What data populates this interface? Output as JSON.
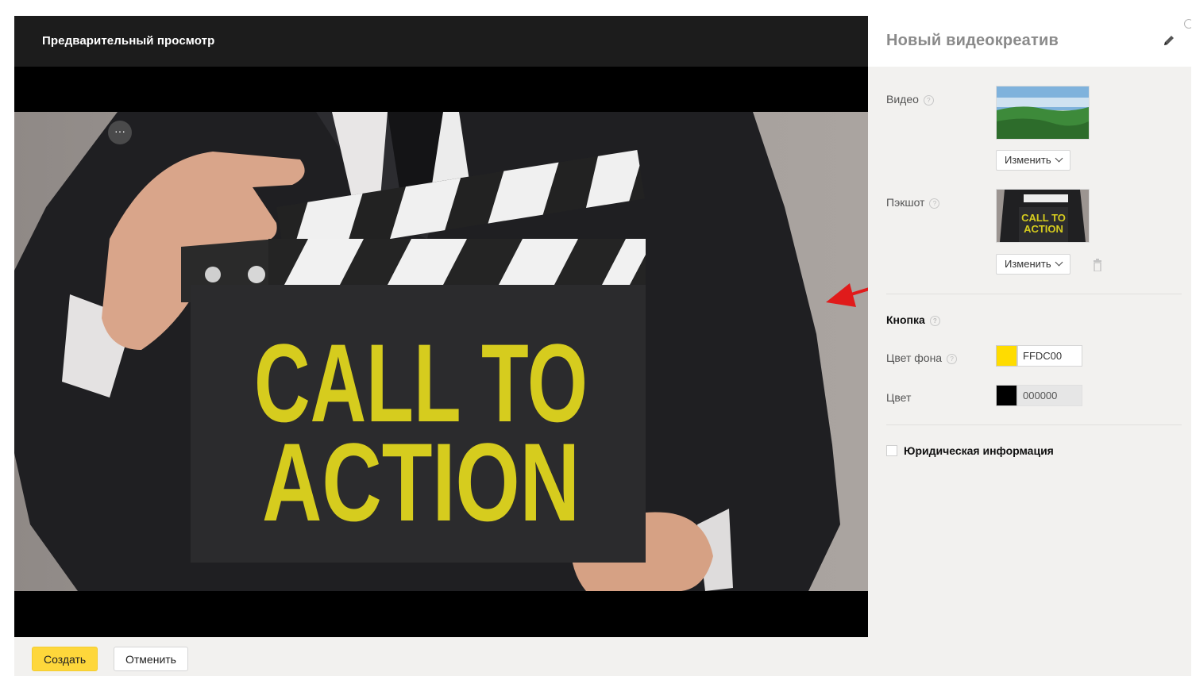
{
  "preview": {
    "title": "Предварительный просмотр",
    "more_label": "···",
    "image": {
      "line1": "CALL TO",
      "line2": "ACTION"
    }
  },
  "panel": {
    "title": "Новый видеокреатив",
    "video": {
      "label": "Видео",
      "change_label": "Изменить"
    },
    "packshot": {
      "label": "Пэкшот",
      "thumb_line1": "CALL TO",
      "thumb_line2": "ACTION",
      "change_label": "Изменить"
    },
    "button_section": {
      "label": "Кнопка",
      "bg_color_label": "Цвет фона",
      "bg_color_value": "FFDC00",
      "bg_color_hex": "#FFDC00",
      "text_color_label": "Цвет",
      "text_color_value": "000000",
      "text_color_hex": "#000000"
    },
    "legal": {
      "label": "Юридическая информация",
      "checked": false
    },
    "help_glyph": "?"
  },
  "footer": {
    "create_label": "Создать",
    "cancel_label": "Отменить"
  },
  "colors": {
    "accent_yellow": "#FED73B",
    "clapper_text": "#D6CC1E",
    "annotation_arrow": "#E01B1B"
  }
}
